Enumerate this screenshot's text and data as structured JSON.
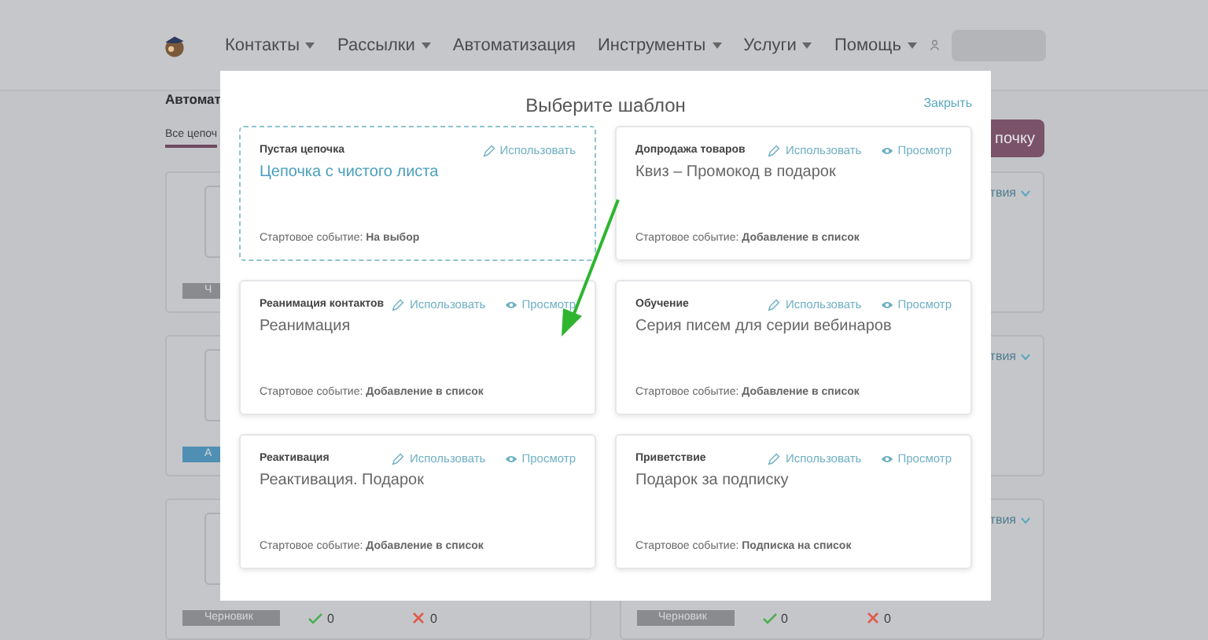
{
  "header": {
    "nav": [
      {
        "label": "Контакты",
        "dropdown": true
      },
      {
        "label": "Рассылки",
        "dropdown": true
      },
      {
        "label": "Автоматизация",
        "dropdown": false
      },
      {
        "label": "Инструменты",
        "dropdown": true
      },
      {
        "label": "Услуги",
        "dropdown": true
      },
      {
        "label": "Помощь",
        "dropdown": true
      }
    ]
  },
  "background": {
    "heading": "Автомат",
    "tab": "Все цепоч",
    "create_button": "почку",
    "cards": [
      {
        "badge": "Ч",
        "color": "#8a8b8f"
      },
      {
        "action": "твия"
      },
      {
        "badge": "А",
        "color": "#4f8fb3"
      },
      {
        "action": "твия"
      },
      {
        "badge": "Черновик",
        "color": "#8a8b8f",
        "ok": "0",
        "fail": "0"
      },
      {
        "badge": "Черновик",
        "color": "#8a8b8f",
        "ok": "0",
        "fail": "0",
        "action": "твия"
      }
    ]
  },
  "modal": {
    "title": "Выберите шаблон",
    "close": "Закрыть",
    "templates": [
      {
        "kind": "blank",
        "category": "Пустая цепочка",
        "name": "Цепочка с чистого листа",
        "actions": [
          {
            "kind": "use",
            "label": "Использовать"
          }
        ],
        "start_event": "Стартовое событие: **На выбор**"
      },
      {
        "kind": "template",
        "category": "Допродажа товаров",
        "name": "Квиз – Промокод в подарок",
        "actions": [
          {
            "kind": "use",
            "label": "Использовать"
          },
          {
            "kind": "view",
            "label": "Просмотр"
          }
        ],
        "start_event": "Стартовое событие: **Добавление в список**"
      },
      {
        "kind": "template",
        "category": "Реанимация контактов",
        "name": "Реанимация",
        "actions": [
          {
            "kind": "use",
            "label": "Использовать"
          },
          {
            "kind": "view",
            "label": "Просмотр"
          }
        ],
        "start_event": "Стартовое событие: **Добавление в список**"
      },
      {
        "kind": "template",
        "category": "Обучение",
        "name": "Серия писем для серии вебинаров",
        "actions": [
          {
            "kind": "use",
            "label": "Использовать"
          },
          {
            "kind": "view",
            "label": "Просмотр"
          }
        ],
        "start_event": "Стартовое событие: **Добавление в список**"
      },
      {
        "kind": "template",
        "category": "Реактивация",
        "name": "Реактивация. Подарок",
        "actions": [
          {
            "kind": "use",
            "label": "Использовать"
          },
          {
            "kind": "view",
            "label": "Просмотр"
          }
        ],
        "start_event": "Стартовое событие: **Добавление в список**"
      },
      {
        "kind": "template",
        "category": "Приветствие",
        "name": "Подарок за подписку",
        "actions": [
          {
            "kind": "use",
            "label": "Использовать"
          },
          {
            "kind": "view",
            "label": "Просмотр"
          }
        ],
        "start_event": "Стартовое событие: **Подписка на список**"
      }
    ]
  }
}
